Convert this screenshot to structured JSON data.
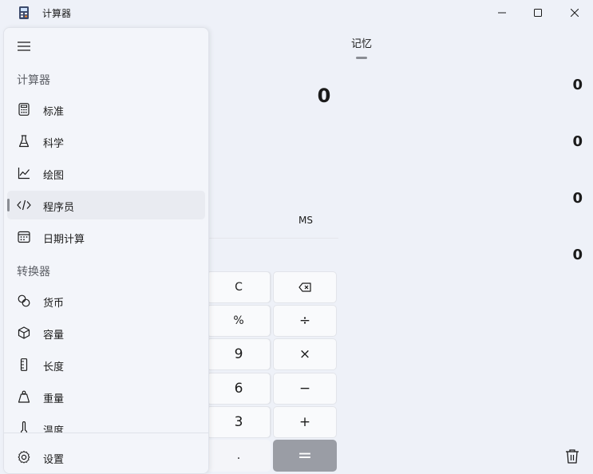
{
  "window": {
    "title": "计算器"
  },
  "memory": {
    "header": "记忆",
    "display_value": "0",
    "values": [
      "0",
      "0",
      "0",
      "0"
    ],
    "ms_label": "MS"
  },
  "keypad": {
    "clear": "C",
    "percent": "%",
    "divide": "÷",
    "multiply": "×",
    "minus": "−",
    "plus": "+",
    "equals": "=",
    "decimal": ".",
    "nine": "9",
    "six": "6",
    "three": "3"
  },
  "nav": {
    "calculator_section": "计算器",
    "converter_section": "转换器",
    "calculator_items": [
      {
        "label": "标准",
        "icon": "standard-calculator-icon"
      },
      {
        "label": "科学",
        "icon": "flask-icon"
      },
      {
        "label": "绘图",
        "icon": "graph-icon"
      },
      {
        "label": "程序员",
        "icon": "code-icon",
        "selected": true
      },
      {
        "label": "日期计算",
        "icon": "calendar-icon"
      }
    ],
    "converter_items": [
      {
        "label": "货币",
        "icon": "currency-icon"
      },
      {
        "label": "容量",
        "icon": "cube-icon"
      },
      {
        "label": "长度",
        "icon": "ruler-icon"
      },
      {
        "label": "重量",
        "icon": "weight-icon"
      },
      {
        "label": "温度",
        "icon": "thermometer-icon"
      }
    ],
    "settings_label": "设置"
  },
  "colors": {
    "window_bg": "#eef1f8",
    "nav_bg": "#f3f5fa",
    "key_bg": "#f9fafc",
    "equals_bg": "#9a9da5",
    "selected_item_bg": "#e9ebf1"
  }
}
